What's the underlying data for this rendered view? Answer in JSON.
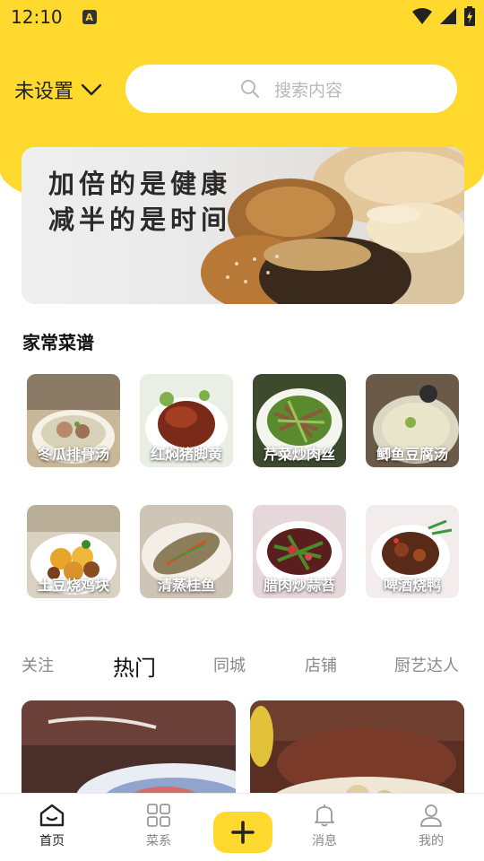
{
  "status_bar": {
    "time": "12:10",
    "notification_letter": "A"
  },
  "header": {
    "location_label": "未设置",
    "search_placeholder": "搜索内容"
  },
  "banner": {
    "line1": "加倍的是健康",
    "line2": "减半的是时间"
  },
  "section": {
    "title": "家常菜谱"
  },
  "recipes": [
    {
      "label": "冬瓜排骨汤"
    },
    {
      "label": "红焖猪脚黄"
    },
    {
      "label": "芹菜炒肉丝"
    },
    {
      "label": "鲫鱼豆腐汤"
    },
    {
      "label": "土豆烧鸡块"
    },
    {
      "label": "清蒸桂鱼"
    },
    {
      "label": "腊肉炒蒜苔"
    },
    {
      "label": "啤酒烧鸭"
    }
  ],
  "feed_tabs": [
    {
      "label": "关注"
    },
    {
      "label": "热门",
      "active": true
    },
    {
      "label": "同城"
    },
    {
      "label": "店铺"
    },
    {
      "label": "厨艺达人"
    }
  ],
  "bottom_nav": [
    {
      "label": "首页",
      "icon": "home-icon",
      "active": true
    },
    {
      "label": "菜系",
      "icon": "grid-icon"
    },
    {
      "label": "消息",
      "icon": "bell-icon"
    },
    {
      "label": "我的",
      "icon": "user-icon"
    }
  ],
  "colors": {
    "accent": "#ffd92e",
    "text_dark": "#222222",
    "text_muted": "#888888"
  }
}
